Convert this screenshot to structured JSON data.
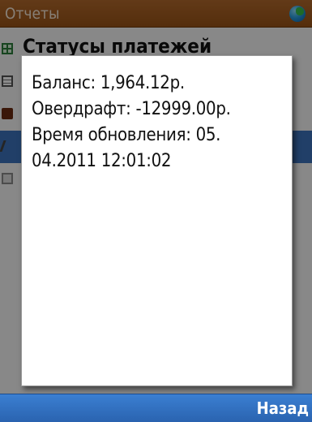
{
  "titlebar": {
    "title": "Отчеты",
    "icon": "globe-icon"
  },
  "list": {
    "items": [
      {
        "label": "Статусы платежей",
        "icon": "grid-icon"
      },
      {
        "label": "",
        "icon": "document-icon"
      },
      {
        "label": "",
        "icon": "book-icon"
      },
      {
        "label": "",
        "icon": "pen-icon",
        "selected": true
      },
      {
        "label": "",
        "icon": "box-icon"
      }
    ]
  },
  "dialog": {
    "balance": "Баланс: 1,964.12р.",
    "overdraft": "Овердрафт: -12999.00р.",
    "update_line1": "Время обновления: 05.",
    "update_line2": "04.2011 12:01:02"
  },
  "softkeys": {
    "right": "Назад"
  },
  "colors": {
    "titlebar": "#9a5417",
    "softbar": "#2a63b0",
    "selection": "#3c74bd"
  }
}
